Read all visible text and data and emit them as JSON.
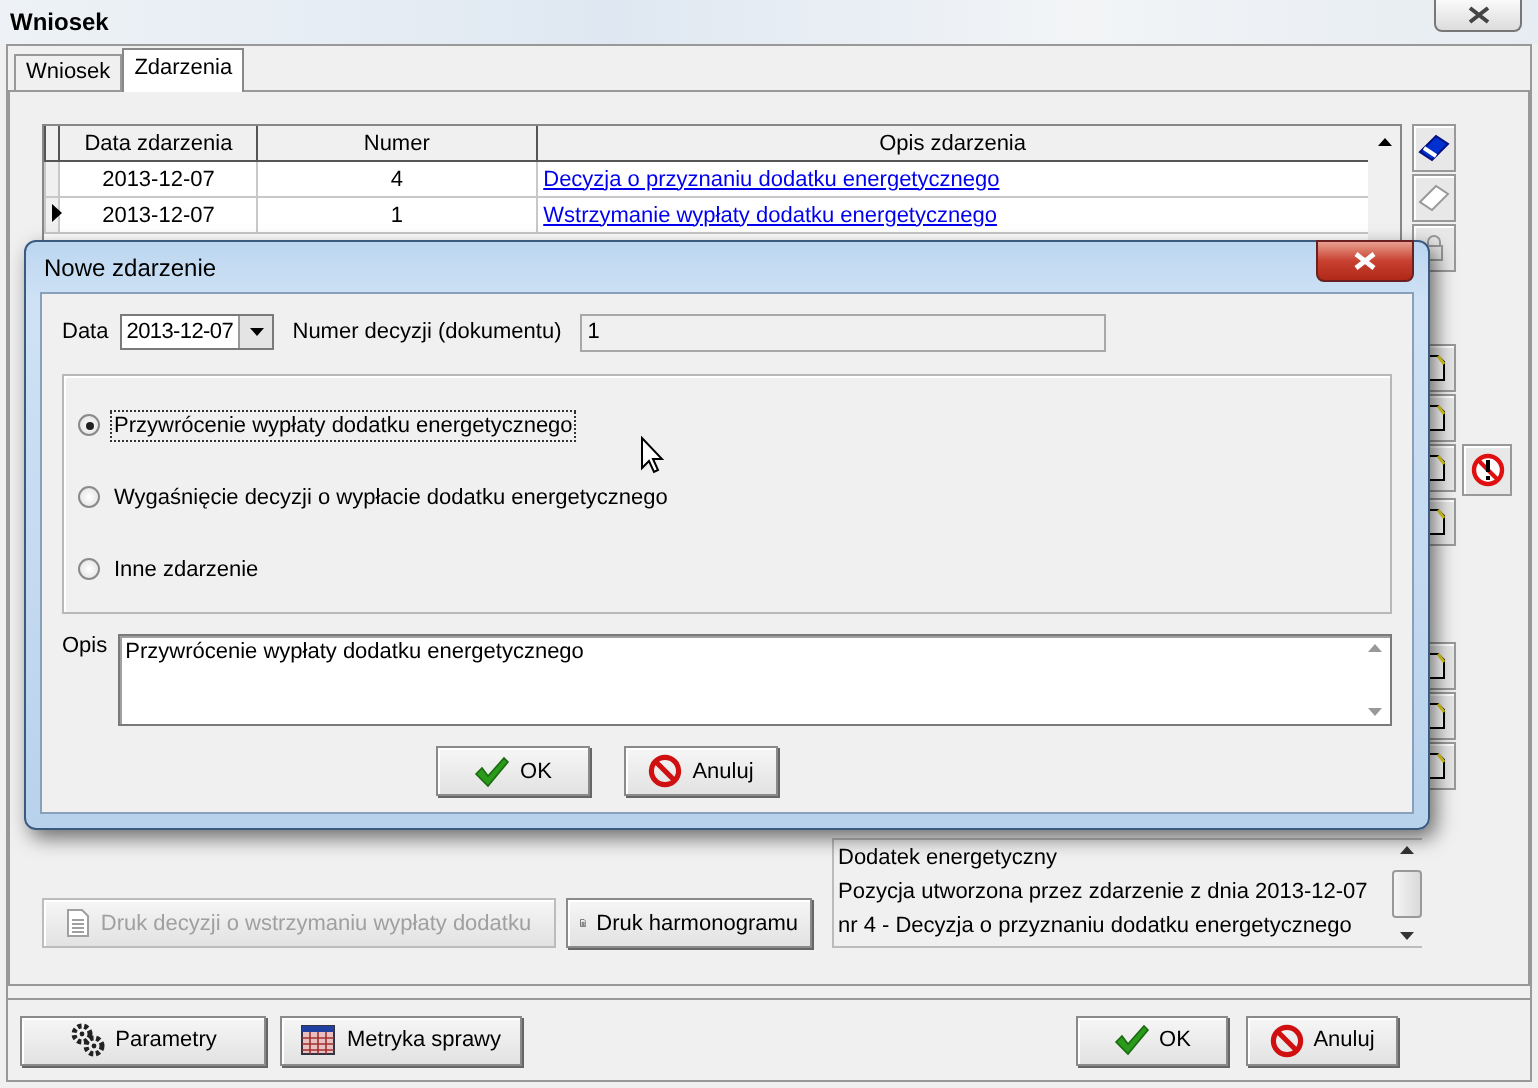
{
  "window": {
    "title": "Wniosek"
  },
  "tabs": [
    {
      "label": "Wniosek",
      "selected": false
    },
    {
      "label": "Zdarzenia",
      "selected": true
    }
  ],
  "events_table": {
    "columns": [
      "Data zdarzenia",
      "Numer",
      "Opis zdarzenia"
    ],
    "rows": [
      {
        "date": "2013-12-07",
        "number": "4",
        "description": "Decyzja o przyznaniu dodatku energetycznego",
        "selected": false
      },
      {
        "date": "2013-12-07",
        "number": "1",
        "description": "Wstrzymanie wypłaty dodatku energetycznego",
        "selected": true
      }
    ]
  },
  "print_buttons": [
    {
      "label": "Druk decyzji o wstrzymaniu wypłaty dodatku",
      "disabled": true
    },
    {
      "label": "Druk harmonogramu",
      "disabled": false
    }
  ],
  "info_lines": [
    "Dodatek energetyczny",
    "Pozycja utworzona przez zdarzenie z dnia 2013-12-07",
    "nr 4 - Decyzja o przyznaniu dodatku energetycznego"
  ],
  "footer_buttons": [
    {
      "label": "Parametry",
      "kind": "params"
    },
    {
      "label": "Metryka sprawy",
      "kind": "calendar"
    },
    {
      "label": "OK",
      "kind": "ok"
    },
    {
      "label": "Anuluj",
      "kind": "cancel"
    }
  ],
  "dialog": {
    "title": "Nowe zdarzenie",
    "date_label": "Data",
    "date": "2013-12-07",
    "number_label": "Numer decyzji (dokumentu)",
    "number": "1",
    "options": [
      {
        "label": "Przywrócenie wypłaty dodatku energetycznego",
        "selected": true
      },
      {
        "label": "Wygaśnięcie decyzji o wypłacie dodatku energetycznego",
        "selected": false
      },
      {
        "label": "Inne zdarzenie",
        "selected": false
      }
    ],
    "description_label": "Opis",
    "description": "Przywrócenie wypłaty dodatku energetycznego",
    "buttons": [
      {
        "label": "OK",
        "kind": "ok"
      },
      {
        "label": "Anuluj",
        "kind": "cancel"
      }
    ]
  }
}
